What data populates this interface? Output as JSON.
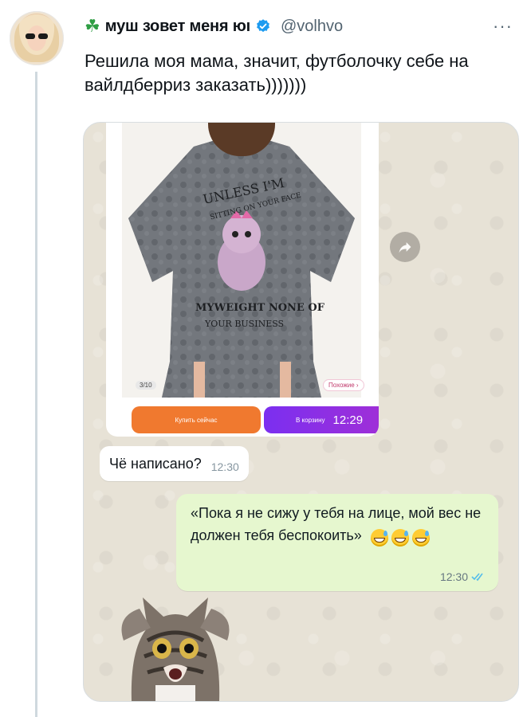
{
  "tweet": {
    "author_emoji": "☘",
    "author_name": "муш зовет меня юı",
    "handle": "@volhvo",
    "more_label": "···",
    "text": "Решила моя мама, значит, футболочку себе на вайлдберриз заказать)))))))",
    "verified_color": "#1d9bf0"
  },
  "chat": {
    "product": {
      "shirt_print_top": "UNLESS I'M",
      "shirt_print_arc": "SITTING ON YOUR FACE",
      "shirt_print_bottom": "MYWEIGHT NONE OF",
      "shirt_print_bottom2": "YOUR BUSINESS",
      "counter": "3/10",
      "similar_label": "Похожие ›",
      "buy_now": "Купить сейчас",
      "to_cart": "В корзину",
      "time": "12:29"
    },
    "incoming": {
      "text": "Чё написано?",
      "time": "12:30"
    },
    "outgoing": {
      "text": "«Пока я не сижу у тебя на лице, мой вес не должен тебя беспокоить»",
      "time": "12:30",
      "status_icon": "double-check-icon"
    },
    "sticker": "shocked-cat-sticker",
    "colors": {
      "buy_button": "#f0792f",
      "cart_button": "#8a2fe6",
      "outgoing_bubble": "#e6f7cf",
      "chat_bg": "#e7e2d6"
    }
  }
}
